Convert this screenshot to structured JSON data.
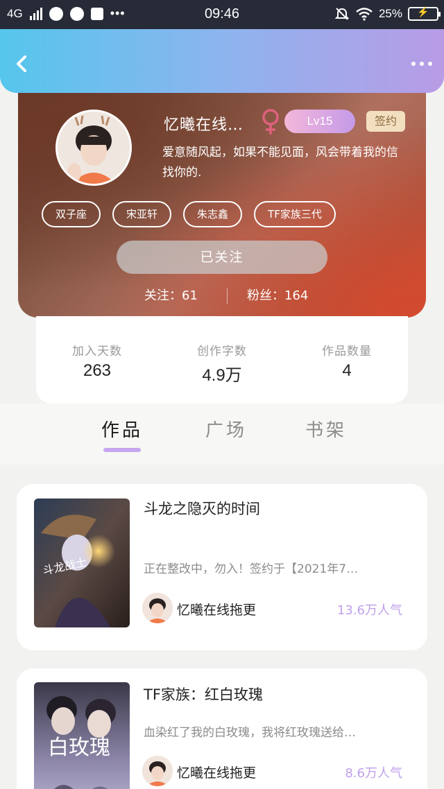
{
  "status_bar": {
    "network": "4G",
    "time": "09:46",
    "battery": "25%"
  },
  "profile": {
    "username": "忆曦在线…",
    "level": "Lv15",
    "sign_badge": "签约",
    "bio_line1": "爱意随风起，如果不能见面，风会带着我的信",
    "bio_line2": "找你的.",
    "tags": [
      "双子座",
      "宋亚轩",
      "朱志鑫",
      "TF家族三代"
    ],
    "follow_button": "已关注",
    "following_label": "关注：",
    "following_count": "61",
    "fans_label": "粉丝：",
    "fans_count": "164"
  },
  "stats": [
    {
      "label": "加入天数",
      "value": "263"
    },
    {
      "label": "创作字数",
      "value": "4.9万"
    },
    {
      "label": "作品数量",
      "value": "4"
    }
  ],
  "tabs": [
    "作品",
    "广场",
    "书架"
  ],
  "works": [
    {
      "title": "斗龙之隐灭的时间",
      "description": "正在整改中，勿入！签约于【2021年7…",
      "author": "忆曦在线拖更",
      "popularity": "13.6万人气"
    },
    {
      "title": "TF家族：红白玫瑰",
      "description": "血染红了我的白玫瑰，我将红玫瑰送给…",
      "author": "忆曦在线拖更",
      "popularity": "8.6万人气"
    }
  ],
  "cover_texts": {
    "work1": "斗龙战士",
    "work2": "白玫瑰"
  },
  "colors": {
    "header_gradient_start": "#55c6ec",
    "header_gradient_end": "#b89ce6",
    "gender_female": "#e0607e",
    "level_badge": "#d7a6e8",
    "accent_purple": "#c7a6f0",
    "popularity": "#bfa0ea"
  },
  "icons": {
    "back": "chevron-left-icon",
    "more": "more-dots-icon",
    "gender": "female-symbol-icon"
  }
}
